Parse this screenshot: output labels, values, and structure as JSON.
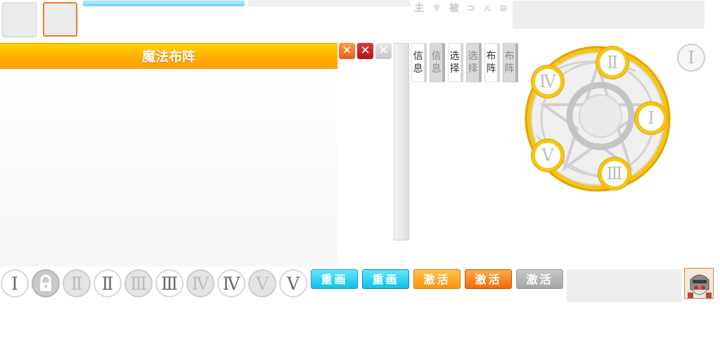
{
  "top_icons": [
    "主",
    "♆",
    "被",
    "⊃",
    "⚔",
    "≋"
  ],
  "panel": {
    "title": "魔法布阵"
  },
  "close_buttons": [
    "✕",
    "✕",
    "✕"
  ],
  "side_tabs": [
    {
      "label": "信息",
      "state": "active"
    },
    {
      "label": "信息",
      "state": "inactive"
    },
    {
      "label": "选择",
      "state": "active"
    },
    {
      "label": "选择",
      "state": "inactive"
    },
    {
      "label": "布阵",
      "state": "active"
    },
    {
      "label": "布阵",
      "state": "inactive"
    }
  ],
  "magic_circle": {
    "slots": [
      "Ⅱ",
      "Ⅰ",
      "Ⅲ",
      "Ⅴ",
      "Ⅳ"
    ],
    "corner_numeral": "Ⅰ",
    "colors": {
      "ring": "#f5c518",
      "ring_edge": "#e7a800",
      "inner": "#e6e6e6"
    }
  },
  "formation_slots": [
    {
      "numeral": "Ⅰ",
      "style": "white"
    },
    {
      "numeral": "",
      "style": "locked",
      "icon": "lock-icon"
    },
    {
      "numeral": "Ⅱ",
      "style": "gray"
    },
    {
      "numeral": "Ⅱ",
      "style": "white"
    },
    {
      "numeral": "Ⅲ",
      "style": "gray"
    },
    {
      "numeral": "Ⅲ",
      "style": "white"
    },
    {
      "numeral": "Ⅳ",
      "style": "gray"
    },
    {
      "numeral": "Ⅳ",
      "style": "white"
    },
    {
      "numeral": "Ⅴ",
      "style": "gray"
    },
    {
      "numeral": "Ⅴ",
      "style": "white"
    }
  ],
  "buttons": {
    "redraw_1": "重画",
    "redraw_2": "重画",
    "activate_1": "激活",
    "activate_2": "激活",
    "activate_disabled": "激活"
  },
  "colors": {
    "title_orange": "#ffb000",
    "cyan": "#14bfe6",
    "orange": "#f79510",
    "selected_slot_border": "#ef7a22"
  }
}
